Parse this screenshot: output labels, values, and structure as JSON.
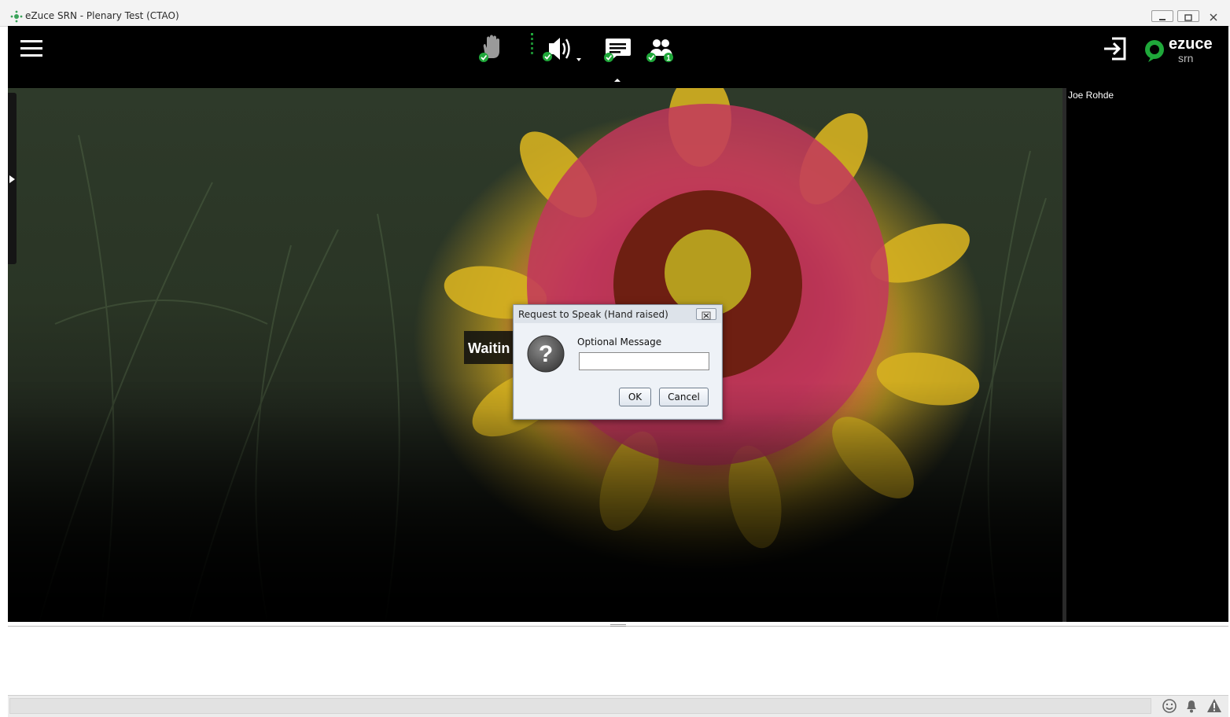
{
  "window": {
    "title": "eZuce SRN - Plenary Test (CTAO)"
  },
  "toolbar": {
    "menu_icon": "hamburger-menu-icon",
    "items": [
      {
        "name": "raise-hand",
        "icon": "hand-icon",
        "status": "check"
      },
      {
        "name": "audio",
        "icon": "speaker-icon",
        "status": "check"
      },
      {
        "name": "chat",
        "icon": "chat-bubble-icon",
        "status": "check"
      },
      {
        "name": "participants",
        "icon": "people-icon",
        "badge": "1"
      }
    ],
    "exit_icon": "exit-icon",
    "logo": {
      "brand": "ezuce",
      "sub": "srn"
    }
  },
  "video": {
    "waiting_text": "Waitin"
  },
  "participants_panel": {
    "names": [
      "Joe Rohde"
    ]
  },
  "dialog": {
    "title": "Request to Speak (Hand raised)",
    "icon": "question-icon",
    "label": "Optional Message",
    "input_value": "",
    "ok_label": "OK",
    "cancel_label": "Cancel"
  },
  "statusbar": {
    "icons": [
      "smiley-icon",
      "bell-icon",
      "warning-icon"
    ]
  },
  "colors": {
    "accent": "#1fa83a",
    "toolbar_bg": "#000000"
  }
}
